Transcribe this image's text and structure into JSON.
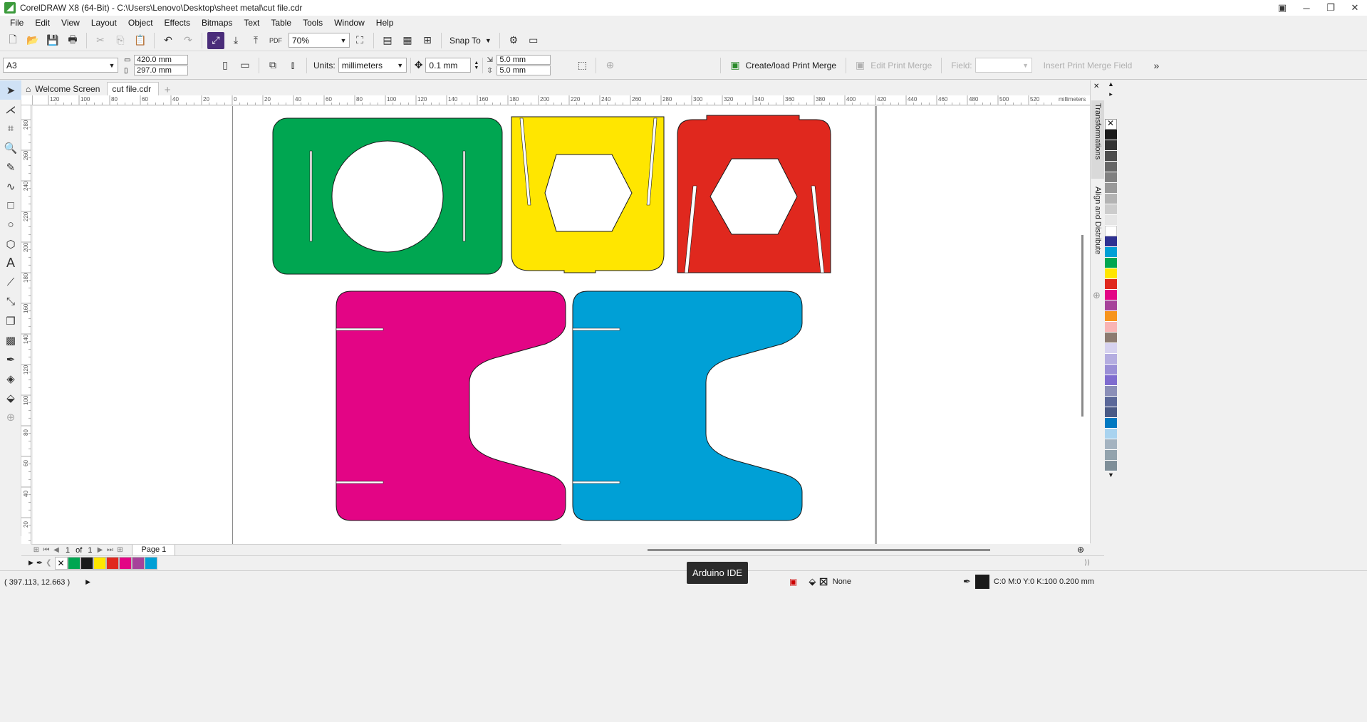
{
  "window": {
    "title": "CorelDRAW X8 (64-Bit) - C:\\Users\\Lenovo\\Desktop\\sheet metal\\cut file.cdr"
  },
  "menu": [
    "File",
    "Edit",
    "View",
    "Layout",
    "Object",
    "Effects",
    "Bitmaps",
    "Text",
    "Table",
    "Tools",
    "Window",
    "Help"
  ],
  "toolbar_standard": {
    "zoom_value": "70%",
    "snap_label": "Snap To"
  },
  "toolbar_property": {
    "page_size": "A3",
    "width": "420.0 mm",
    "height": "297.0 mm",
    "units_label": "Units:",
    "units_value": "millimeters",
    "nudge": "0.1 mm",
    "dup_x": "5.0 mm",
    "dup_y": "5.0 mm",
    "create_merge": "Create/load Print Merge",
    "edit_merge": "Edit Print Merge",
    "field_label": "Field:",
    "insert_merge": "Insert Print Merge Field"
  },
  "tabs": [
    {
      "label": "Welcome Screen",
      "active": false
    },
    {
      "label": "cut file.cdr",
      "active": true
    }
  ],
  "ruler": {
    "h_labels": [
      "120",
      "100",
      "80",
      "60",
      "40",
      "20",
      "0",
      "20",
      "40",
      "60",
      "80",
      "100",
      "120",
      "140",
      "160",
      "180",
      "200",
      "220",
      "240",
      "260",
      "280",
      "300",
      "320",
      "340",
      "360",
      "380",
      "400",
      "420",
      "440",
      "460",
      "480",
      "500",
      "520"
    ],
    "units": "millimeters",
    "v_labels": [
      "280",
      "260",
      "240",
      "220",
      "200",
      "180",
      "160",
      "140",
      "120",
      "100",
      "80",
      "60",
      "40",
      "20"
    ]
  },
  "dockers": {
    "transformations": "Transformations",
    "align": "Align and Distribute"
  },
  "page_nav": {
    "current": "1",
    "of": "of",
    "total": "1",
    "page_tab": "Page 1"
  },
  "colors": {
    "green": "#00a651",
    "yellow": "#ffe600",
    "red": "#e0281e",
    "magenta": "#e30585",
    "cyan": "#00a0d6"
  },
  "status": {
    "coords": "( 397.113, 12.663 )",
    "tooltip": "Arduino IDE",
    "fill": "None",
    "outline": "C:0 M:0 Y:0 K:100  0.200 mm"
  }
}
